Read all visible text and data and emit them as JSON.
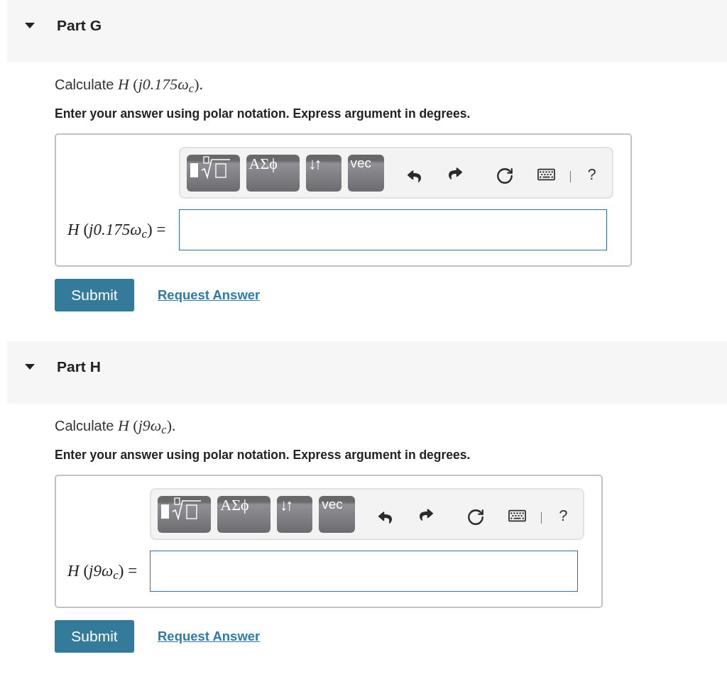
{
  "parts": [
    {
      "title": "Part G",
      "expanded": true,
      "question": {
        "text": "Calculate",
        "expression": "*H* (*j0.175ω*$_{c}$)."
      },
      "instructions": "Enter your answer using polar notation. Express argument in degrees.",
      "answer": {
        "toolbar": {
          "buttons": [
            {
              "kind": "templates"
            },
            {
              "kind": "symbols",
              "label": "ΑΣϕ"
            },
            {
              "kind": "arrows",
              "label": "↓↑"
            },
            {
              "kind": "vector",
              "label": "vec"
            }
          ],
          "help": "?"
        },
        "label": "*H* (*j0.175ω*$_{c}$) ="
      },
      "actions": {
        "submit": "Submit",
        "request": "Request Answer"
      }
    },
    {
      "title": "Part H",
      "expanded": true,
      "question": {
        "text": "Calculate",
        "expression": "*H* (*j9ω*$_{c}$)."
      },
      "instructions": "Enter your answer using polar notation. Express argument in degrees.",
      "answer": {
        "toolbar": {
          "buttons": [
            {
              "kind": "templates"
            },
            {
              "kind": "symbols",
              "label": "ΑΣϕ"
            },
            {
              "kind": "arrows",
              "label": "↓↑"
            },
            {
              "kind": "vector",
              "label": "vec"
            }
          ],
          "help": "?"
        },
        "label": "*H* (*j9ω*$_{c}$) ="
      },
      "actions": {
        "submit": "Submit",
        "request": "Request Answer"
      }
    }
  ]
}
